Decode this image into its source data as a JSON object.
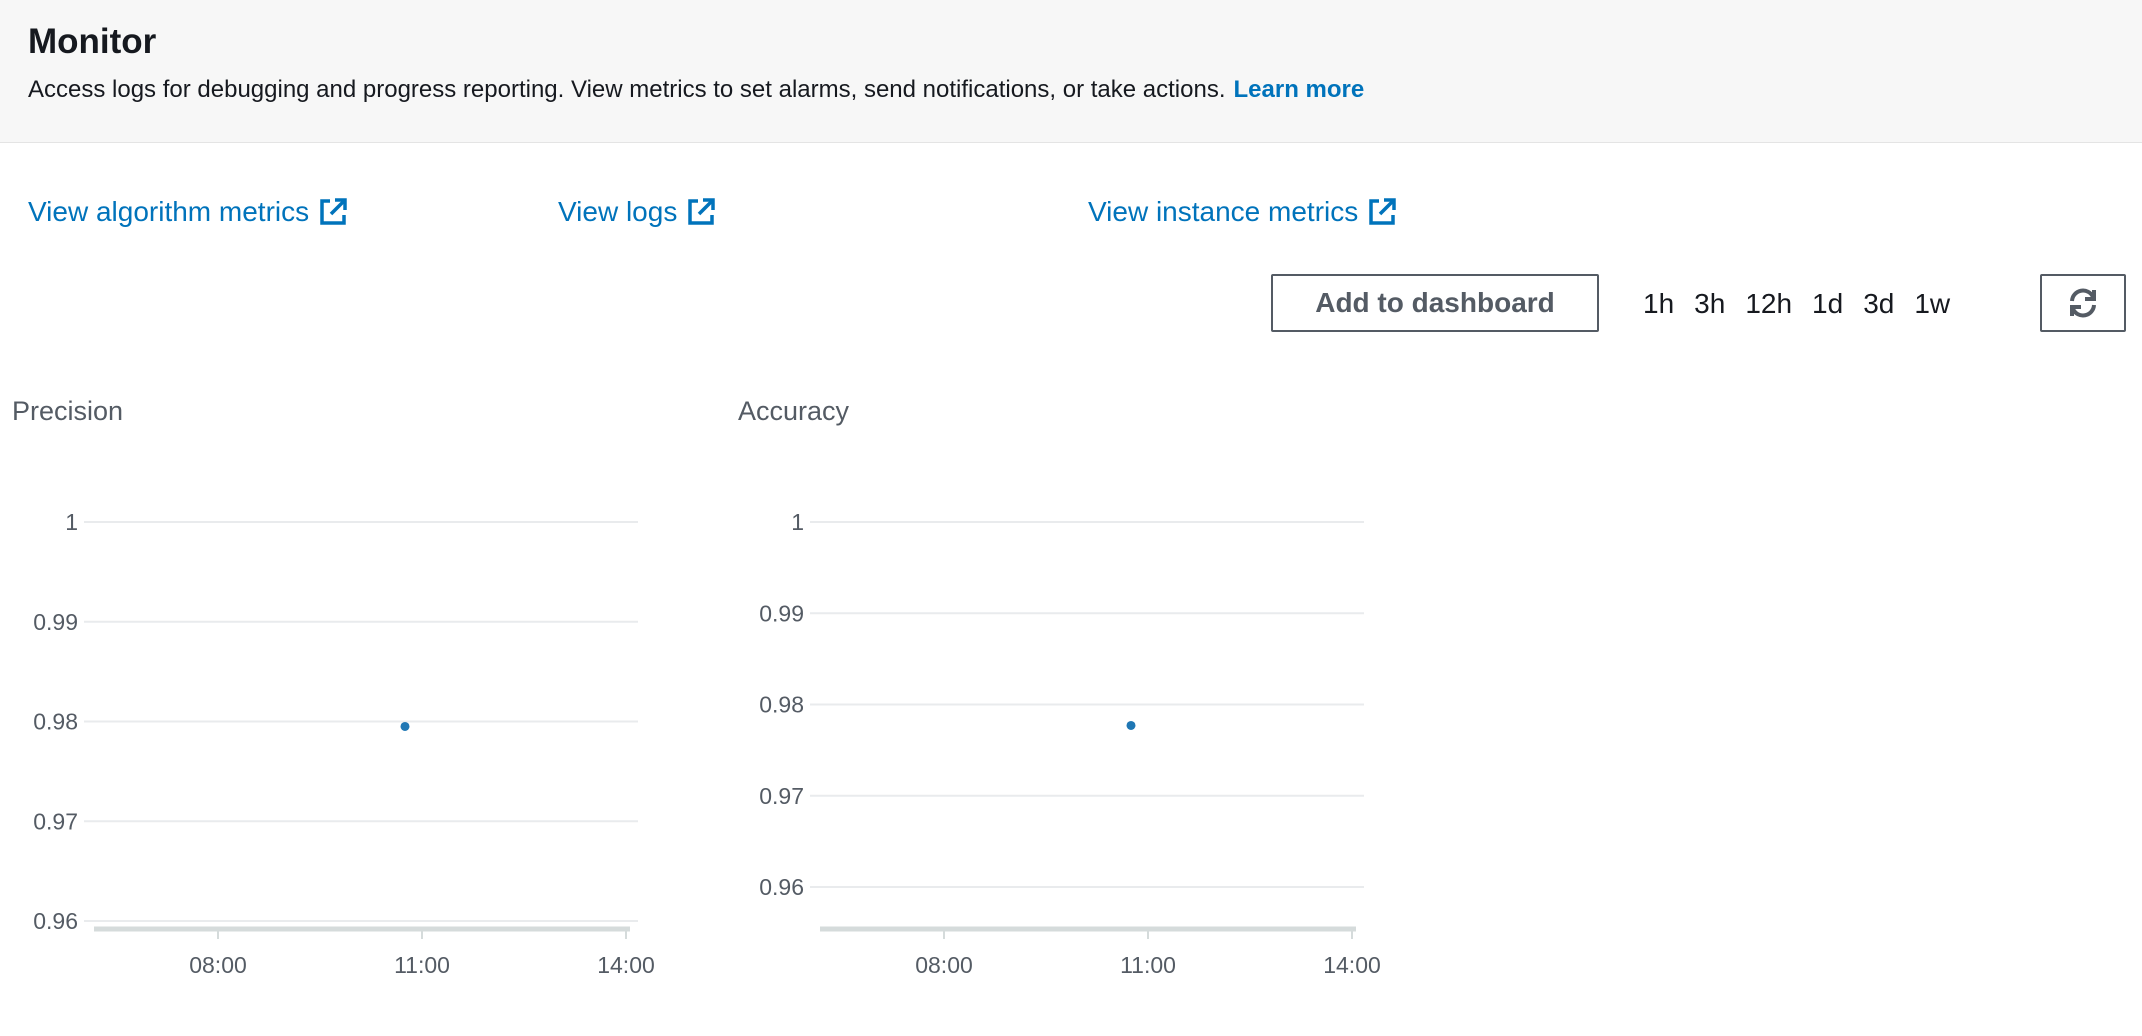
{
  "header": {
    "title": "Monitor",
    "description": "Access logs for debugging and progress reporting. View metrics to set alarms, send notifications, or take actions.",
    "learn_more": "Learn more"
  },
  "links": {
    "algorithm_metrics": "View algorithm metrics",
    "logs": "View logs",
    "instance_metrics": "View instance metrics"
  },
  "toolbar": {
    "add_to_dashboard": "Add to dashboard",
    "ranges": [
      "1h",
      "3h",
      "12h",
      "1d",
      "3d",
      "1w"
    ],
    "refresh_icon": "refresh-icon",
    "external_link_icon": "external-link-icon"
  },
  "colors": {
    "link": "#0073bb",
    "point": "#1f77b4",
    "grid": "#e9ebed",
    "axis": "#d5dbdb"
  },
  "chart_data": [
    {
      "type": "scatter",
      "title": "Precision",
      "xlabel": "",
      "ylabel": "",
      "x_ticks": [
        "08:00",
        "11:00",
        "14:00"
      ],
      "y_ticks": [
        1,
        0.99,
        0.98,
        0.97,
        0.96
      ],
      "ylim": [
        0.96,
        1
      ],
      "points": [
        {
          "x": "10:45",
          "y": 0.9795
        }
      ]
    },
    {
      "type": "scatter",
      "title": "Accuracy",
      "xlabel": "",
      "ylabel": "",
      "x_ticks": [
        "08:00",
        "11:00",
        "14:00"
      ],
      "y_ticks": [
        1,
        0.99,
        0.98,
        0.97,
        0.96
      ],
      "ylim": [
        0.96,
        1
      ],
      "points": [
        {
          "x": "10:45",
          "y": 0.9777
        }
      ]
    }
  ]
}
